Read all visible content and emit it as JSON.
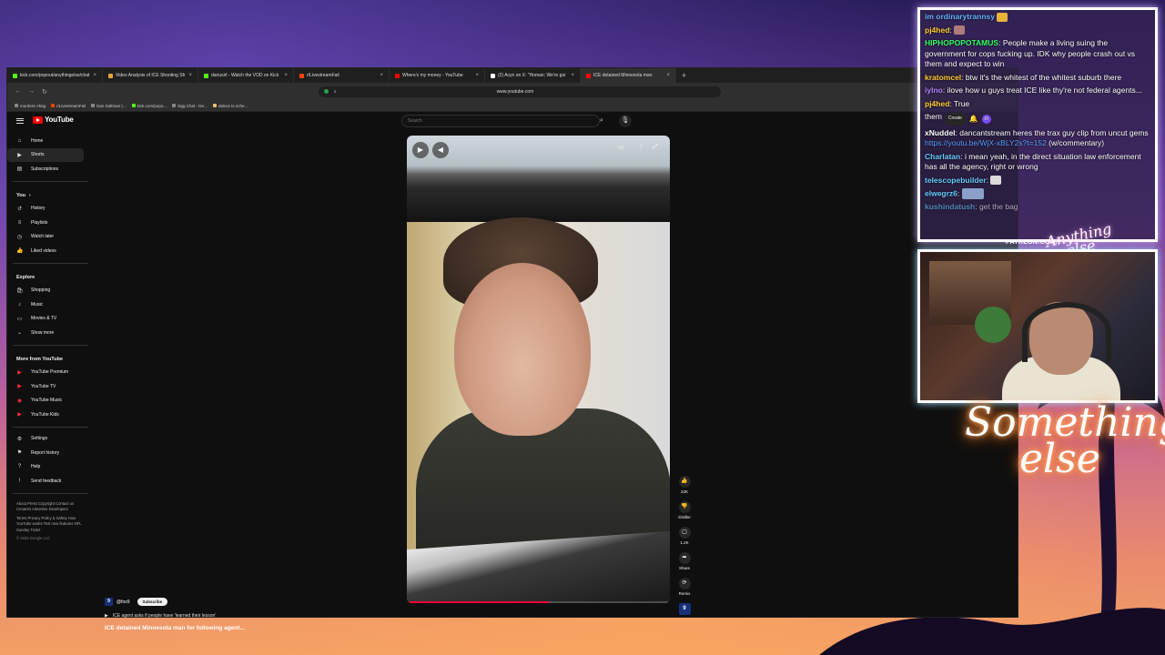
{
  "browser": {
    "tabs": [
      {
        "label": "kick.com/popout/anythingelse/chat",
        "color": "#53fc18"
      },
      {
        "label": "Video Analysis of ICE Shooting Sh",
        "color": "#e8a53a"
      },
      {
        "label": "dariusirl - Watch the VOD on Kick",
        "color": "#53fc18"
      },
      {
        "label": "r/LivestreamFail",
        "color": "#ff4500"
      },
      {
        "label": "Where's my money - YouTube",
        "color": "#ff0000"
      },
      {
        "label": "(2) Acyn on X: \"Homan: We're goi",
        "color": "#ffffff"
      },
      {
        "label": "ICE detained Minnesota man",
        "color": "#ff0000"
      }
    ],
    "new_tab": "+",
    "url": "www.youtube.com",
    "bookmarks": [
      "murders->bag",
      "r/LivestreamFail",
      "Dan Saltman (...",
      "kick.com/popo...",
      "Dgg Chat - De...",
      "videos to sche..."
    ]
  },
  "youtube": {
    "logo": "YouTube",
    "search_placeholder": "Search",
    "sidebar": {
      "main": [
        {
          "label": "Home",
          "icon": "home-icon"
        },
        {
          "label": "Shorts",
          "icon": "shorts-icon"
        },
        {
          "label": "Subscriptions",
          "icon": "subscriptions-icon"
        }
      ],
      "you_header": "You",
      "you": [
        {
          "label": "History",
          "icon": "history-icon"
        },
        {
          "label": "Playlists",
          "icon": "playlists-icon"
        },
        {
          "label": "Watch later",
          "icon": "watch-later-icon"
        },
        {
          "label": "Liked videos",
          "icon": "like-icon"
        }
      ],
      "explore_header": "Explore",
      "explore": [
        {
          "label": "Shopping",
          "icon": "shopping-icon"
        },
        {
          "label": "Music",
          "icon": "music-icon"
        },
        {
          "label": "Movies & TV",
          "icon": "movies-icon"
        },
        {
          "label": "Show more",
          "icon": "chevron-down-icon"
        }
      ],
      "more_header": "More from YouTube",
      "more": [
        {
          "label": "YouTube Premium"
        },
        {
          "label": "YouTube TV"
        },
        {
          "label": "YouTube Music"
        },
        {
          "label": "YouTube Kids"
        }
      ],
      "settings": [
        {
          "label": "Settings",
          "icon": "gear-icon"
        },
        {
          "label": "Report history",
          "icon": "flag-icon"
        },
        {
          "label": "Help",
          "icon": "help-icon"
        },
        {
          "label": "Send feedback",
          "icon": "feedback-icon"
        }
      ],
      "footer1": "About  Press  Copyright  Contact us  Creators  Advertise  Developers",
      "footer2": "Terms  Privacy  Policy & Safety  How YouTube works  Test new features  NFL Sunday Ticket",
      "copyright": "© 2026 Google LLC"
    },
    "short": {
      "progress_fraction": 0.54,
      "actions": {
        "likes": "22K",
        "dislike": "Dislike",
        "comments": "1.2K",
        "share": "Share",
        "remix": "Remix",
        "channel_badge": "9"
      },
      "channel_avatar": "9",
      "channel": "@fox9",
      "subscribe": "Subscribe",
      "related": "ICE agent asks if people have 'learned their lesson'",
      "title": "ICE detained Minnesota man for following agent..."
    }
  },
  "chat": {
    "messages": [
      {
        "user": "im ordinarytrannsy",
        "text": "",
        "color": "#66b3ff"
      },
      {
        "user": "pj4hed",
        "text": "",
        "color": "#ffcc33"
      },
      {
        "user": "HIPHOPOPOTAMUS",
        "text": "People make a living suing the government for cops fucking up. IDK why people crash out vs them and expect to win",
        "color": "#33ff66"
      },
      {
        "user": "kratomcel",
        "text": "btw it's the whitest of the whitest suburb there",
        "color": "#ffcc33"
      },
      {
        "user": "iylno",
        "text": "ilove how u guys treat ICE like thy're not federal agents...",
        "color": "#b388ff"
      },
      {
        "user": "pj4hed",
        "text": "True",
        "color": "#ffcc33"
      },
      {
        "user": "",
        "text": "them",
        "color": "#ffffff"
      },
      {
        "user": "xNuddel",
        "text": "dancantstream heres the trax guy clip from uncut gems",
        "link": "https://youtu.be/WjX-xBLY2s?t=152",
        "tail": "(w/commentary)",
        "color": "#ffffff"
      },
      {
        "user": "Charlatan",
        "text": "i mean yeah, in the direct situation law enforcement has all the agency, right or wrong",
        "color": "#66ccff"
      },
      {
        "user": "telescopebuilder",
        "text": "",
        "color": "#66ccff"
      },
      {
        "user": "elwegrz6",
        "text": "",
        "color": "#66ccff"
      },
      {
        "user": "kushindatush",
        "text": "get the bag",
        "color": "#66ccff"
      }
    ],
    "yt_create": "Create",
    "yt_avatar": "m"
  },
  "overlay": {
    "patreon": "PATREON.COM/",
    "brand_small_1": "Anything",
    "brand_small_2": "else",
    "neon_1": "Something",
    "neon_2": "else"
  }
}
